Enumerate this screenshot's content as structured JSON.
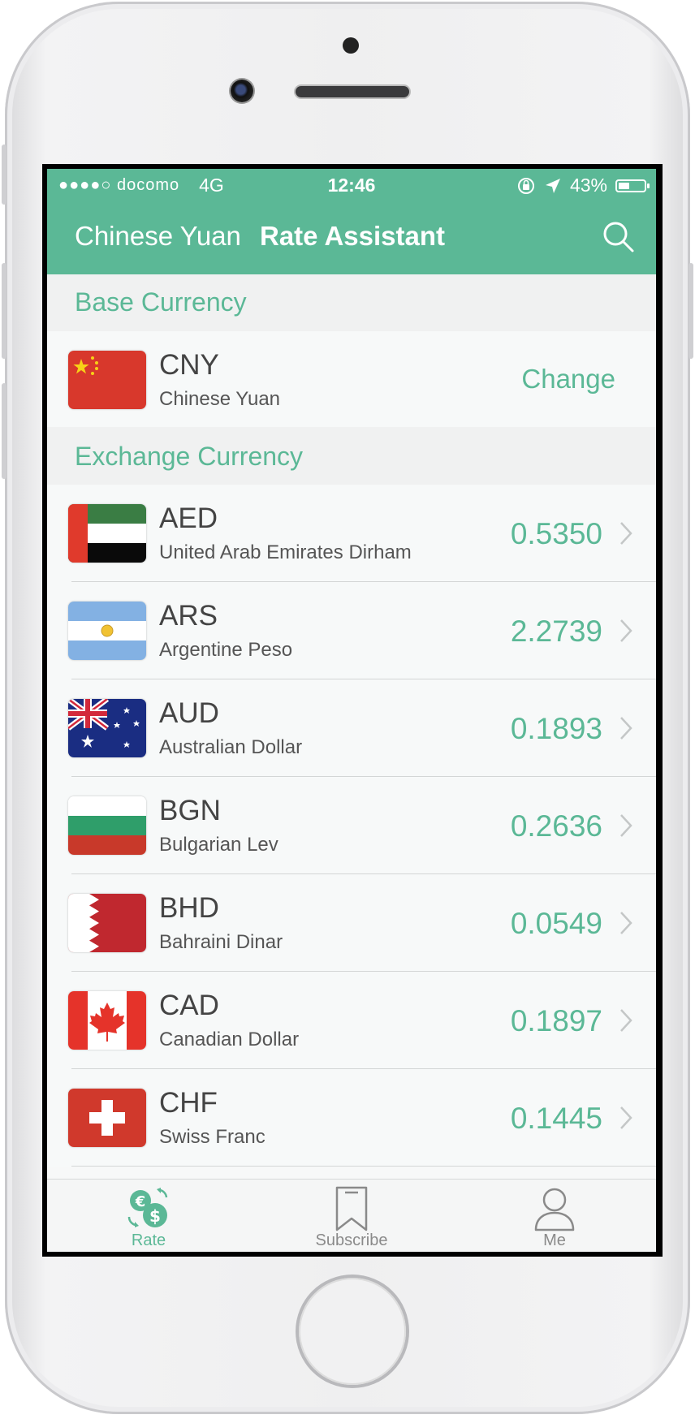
{
  "status_bar": {
    "carrier": "●●●●○ docomo",
    "network": "4G",
    "time": "12:46",
    "battery": "43%",
    "battery_level": 0.43
  },
  "nav": {
    "left_label": "Chinese Yuan",
    "title": "Rate Assistant",
    "search_icon": "search-icon"
  },
  "base_section": {
    "header": "Base Currency",
    "code": "CNY",
    "name": "Chinese Yuan",
    "action": "Change"
  },
  "exchange_section": {
    "header": "Exchange Currency",
    "items": [
      {
        "code": "AED",
        "name": "United Arab Emirates Dirham",
        "rate": "0.5350"
      },
      {
        "code": "ARS",
        "name": "Argentine Peso",
        "rate": "2.2739"
      },
      {
        "code": "AUD",
        "name": "Australian Dollar",
        "rate": "0.1893"
      },
      {
        "code": "BGN",
        "name": "Bulgarian Lev",
        "rate": "0.2636"
      },
      {
        "code": "BHD",
        "name": "Bahraini Dinar",
        "rate": "0.0549"
      },
      {
        "code": "CAD",
        "name": "Canadian Dollar",
        "rate": "0.1897"
      },
      {
        "code": "CHF",
        "name": "Swiss Franc",
        "rate": "0.1445"
      }
    ]
  },
  "tabs": [
    {
      "label": "Rate",
      "icon": "currency-exchange-icon",
      "active": true
    },
    {
      "label": "Subscribe",
      "icon": "bookmark-icon",
      "active": false
    },
    {
      "label": "Me",
      "icon": "person-icon",
      "active": false
    }
  ],
  "colors": {
    "accent": "#5bb896",
    "text": "#444444",
    "subtext": "#555555"
  }
}
